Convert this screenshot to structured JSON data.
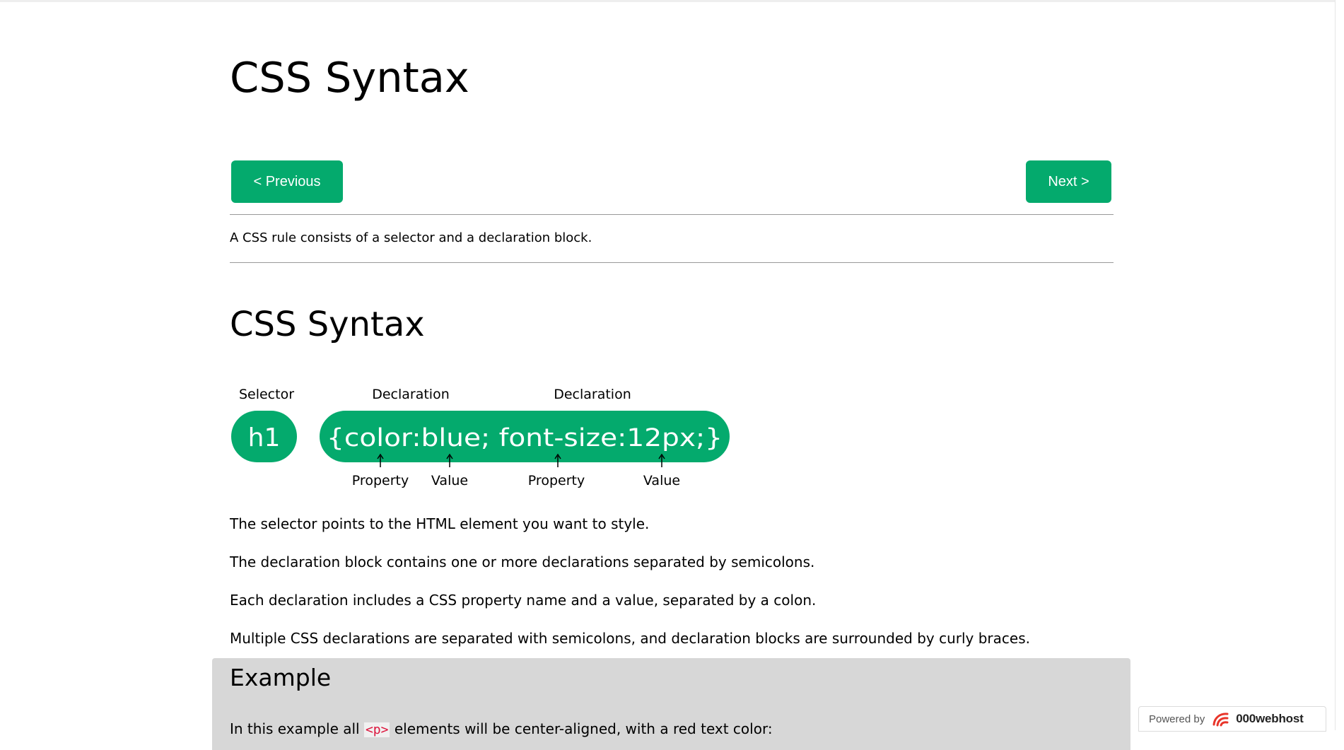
{
  "page": {
    "title": "CSS Syntax",
    "intro": "A CSS rule consists of a selector and a declaration block."
  },
  "nav": {
    "previous_label": "< Previous",
    "next_label": "Next >"
  },
  "section": {
    "title": "CSS Syntax",
    "paragraphs": [
      "The selector points to the HTML element you want to style.",
      "The declaration block contains one or more declarations separated by semicolons.",
      "Each declaration includes a CSS property name and a value, separated by a colon.",
      "Multiple CSS declarations are separated with semicolons, and declaration blocks are surrounded by curly braces."
    ]
  },
  "diagram": {
    "selector_label": "Selector",
    "declaration_label_1": "Declaration",
    "declaration_label_2": "Declaration",
    "selector_code": "h1",
    "declaration_code": "{color:blue; font-size:12px;}",
    "property_label_1": "Property",
    "value_label_1": "Value",
    "property_label_2": "Property",
    "value_label_2": "Value"
  },
  "example": {
    "title": "Example",
    "text_before": "In this example all ",
    "code": "<p>",
    "text_after": " elements will be center-aligned, with a red text color:"
  },
  "badge": {
    "prefix": "Powered by",
    "brand": "000webhost"
  },
  "colors": {
    "accent": "#04aa6d",
    "example_bg": "#d7d7d7"
  }
}
